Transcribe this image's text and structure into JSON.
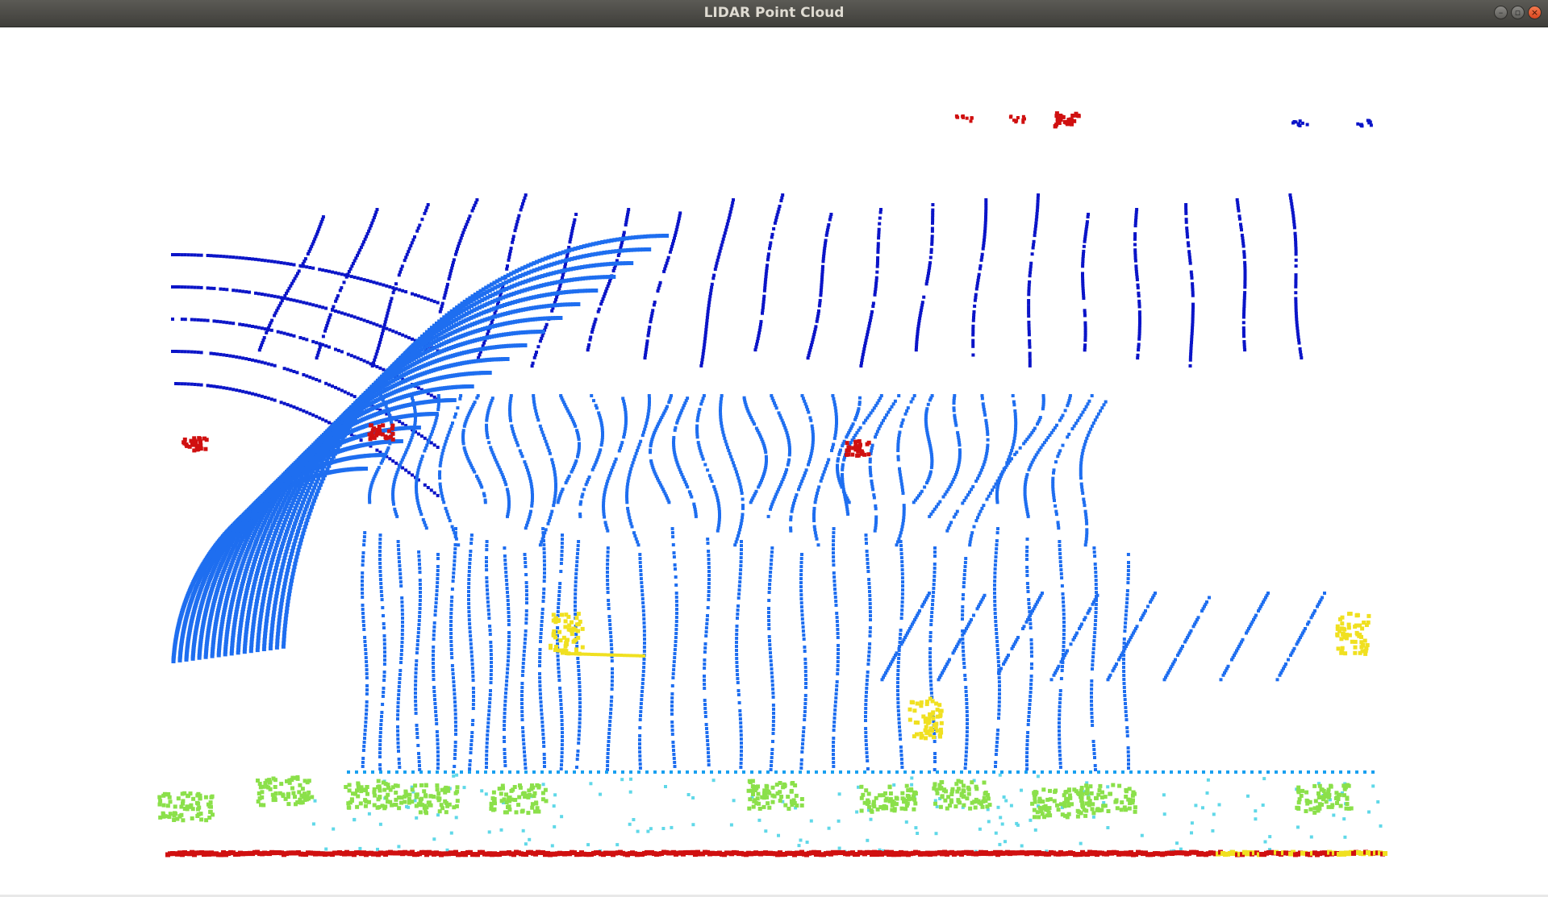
{
  "window": {
    "title": "LIDAR Point Cloud",
    "controls": {
      "minimize_icon": "minimize-icon",
      "maximize_icon": "maximize-icon",
      "close_icon": "close-icon"
    }
  },
  "colors": {
    "background": "#ffffff",
    "titlebar": "#4a4945",
    "title_text": "#dfdbd2",
    "close_button": "#e9541f",
    "far_points": "#0a14c8",
    "mid_points": "#1e6ef0",
    "near_points": "#1aa0f0",
    "ground_points": "#60d8e8",
    "vegetation": "#8be04a",
    "objects_hot": "#d01010",
    "objects_warm": "#f0e020"
  }
}
